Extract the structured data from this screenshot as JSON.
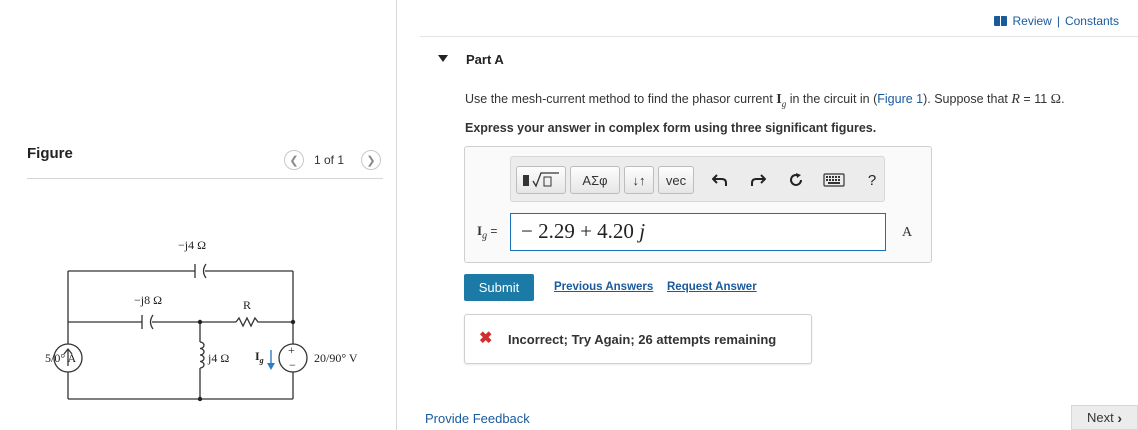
{
  "figure_panel": {
    "title": "Figure",
    "pager": "1 of 1",
    "prev_icon": "chevron-left-icon",
    "next_icon": "chevron-right-icon"
  },
  "circuit": {
    "cap_top": "−j4 Ω",
    "cap_mid": "−j8 Ω",
    "resistor": "R",
    "inductor": "j4 Ω",
    "current_source": "5/0° A",
    "voltage_source": "20/90° V",
    "ig_label": "I",
    "ig_sub": "g"
  },
  "header": {
    "review": "Review",
    "separator": "|",
    "constants": "Constants"
  },
  "part": {
    "title": "Part A"
  },
  "question": {
    "prefix": "Use the mesh-current method to find the phasor current",
    "var": "I",
    "var_sub": "g",
    "middle": "in the circuit in (",
    "figure_link": "Figure 1",
    "suffix": "). Suppose that",
    "r_var": "R",
    "r_value": "= 11",
    "r_unit": "Ω",
    "end": "."
  },
  "instruction": "Express your answer in complex form using three significant figures.",
  "toolbar": {
    "buttons": [
      "Σφ",
      "↓↑",
      "vec"
    ],
    "alpha": "ΑΣφ",
    "sort": "↓↑",
    "vec": "vec",
    "help": "?",
    "icons": [
      "template-icon",
      "undo-icon",
      "redo-icon",
      "reset-icon",
      "keyboard-icon",
      "help-icon"
    ]
  },
  "answer": {
    "label": "I",
    "label_sub": "g",
    "equals": "=",
    "value": "− 2.29 + 4.20",
    "value_j": "j",
    "unit": "A"
  },
  "actions": {
    "submit": "Submit",
    "previous_answers": "Previous Answers",
    "request_answer": "Request Answer"
  },
  "feedback": {
    "icon": "x-icon",
    "text": "Incorrect; Try Again; 26 attempts remaining"
  },
  "footer": {
    "provide_feedback": "Provide Feedback",
    "next": "Next"
  },
  "colors": {
    "link": "#1a5a9c",
    "submit_bg": "#1c7ba6",
    "error": "#d22d2d",
    "input_border": "#1a6fb4"
  }
}
